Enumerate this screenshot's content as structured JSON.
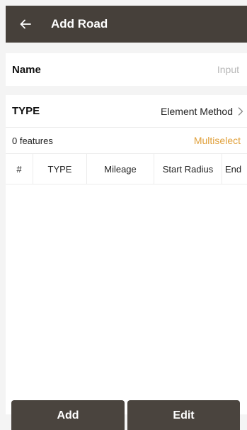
{
  "header": {
    "title": "Add Road",
    "back_icon": "arrow-left-icon"
  },
  "form": {
    "name_label": "Name",
    "name_placeholder": "Input",
    "name_value": "",
    "type_label": "TYPE",
    "type_value": "Element Method",
    "type_chevron_icon": "chevron-right-icon"
  },
  "features": {
    "count_label": "0 features",
    "multiselect_label": "Multiselect"
  },
  "table": {
    "columns": [
      "#",
      "TYPE",
      "Mileage",
      "Start Radius",
      "End"
    ],
    "rows": []
  },
  "actions": {
    "add_label": "Add",
    "edit_label": "Edit"
  },
  "colors": {
    "header_bg": "#46403a",
    "accent": "#e0a03b",
    "button_bg": "#4a443e"
  }
}
